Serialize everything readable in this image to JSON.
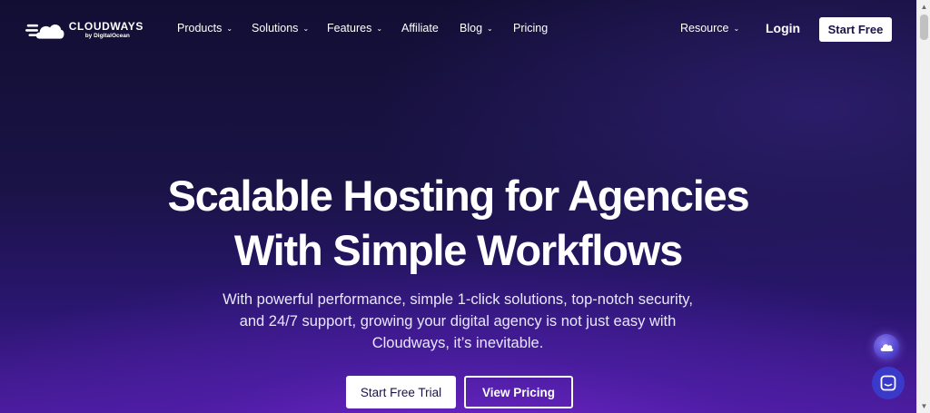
{
  "brand": {
    "name": "CLOUDWAYS",
    "sub": "by DigitalOcean"
  },
  "nav": {
    "items": [
      {
        "label": "Products",
        "has_dropdown": true
      },
      {
        "label": "Solutions",
        "has_dropdown": true
      },
      {
        "label": "Features",
        "has_dropdown": true
      },
      {
        "label": "Affiliate",
        "has_dropdown": false
      },
      {
        "label": "Blog",
        "has_dropdown": true
      },
      {
        "label": "Pricing",
        "has_dropdown": false
      }
    ],
    "resource_label": "Resource",
    "login_label": "Login",
    "start_free_label": "Start Free",
    "chevron": "⌄"
  },
  "hero": {
    "title_line1": "Scalable Hosting for Agencies",
    "title_line2": "With Simple Workflows",
    "subtitle_line1": "With powerful performance, simple 1-click solutions, top-notch security,",
    "subtitle_line2": "and 24/7 support, growing your digital agency is not just easy with",
    "subtitle_line3": "Cloudways, it’s inevitable.",
    "trial_button": "Start Free Trial",
    "pricing_button": "View Pricing"
  },
  "icons": {
    "logo": "cloudways-logo-icon",
    "floating": "cloud-icon",
    "chat": "chat-icon"
  },
  "colors": {
    "background_top": "#120e33",
    "background_bottom": "#4a1c9c",
    "chat_button": "#3a39c9",
    "button_text": "#1a1346"
  }
}
